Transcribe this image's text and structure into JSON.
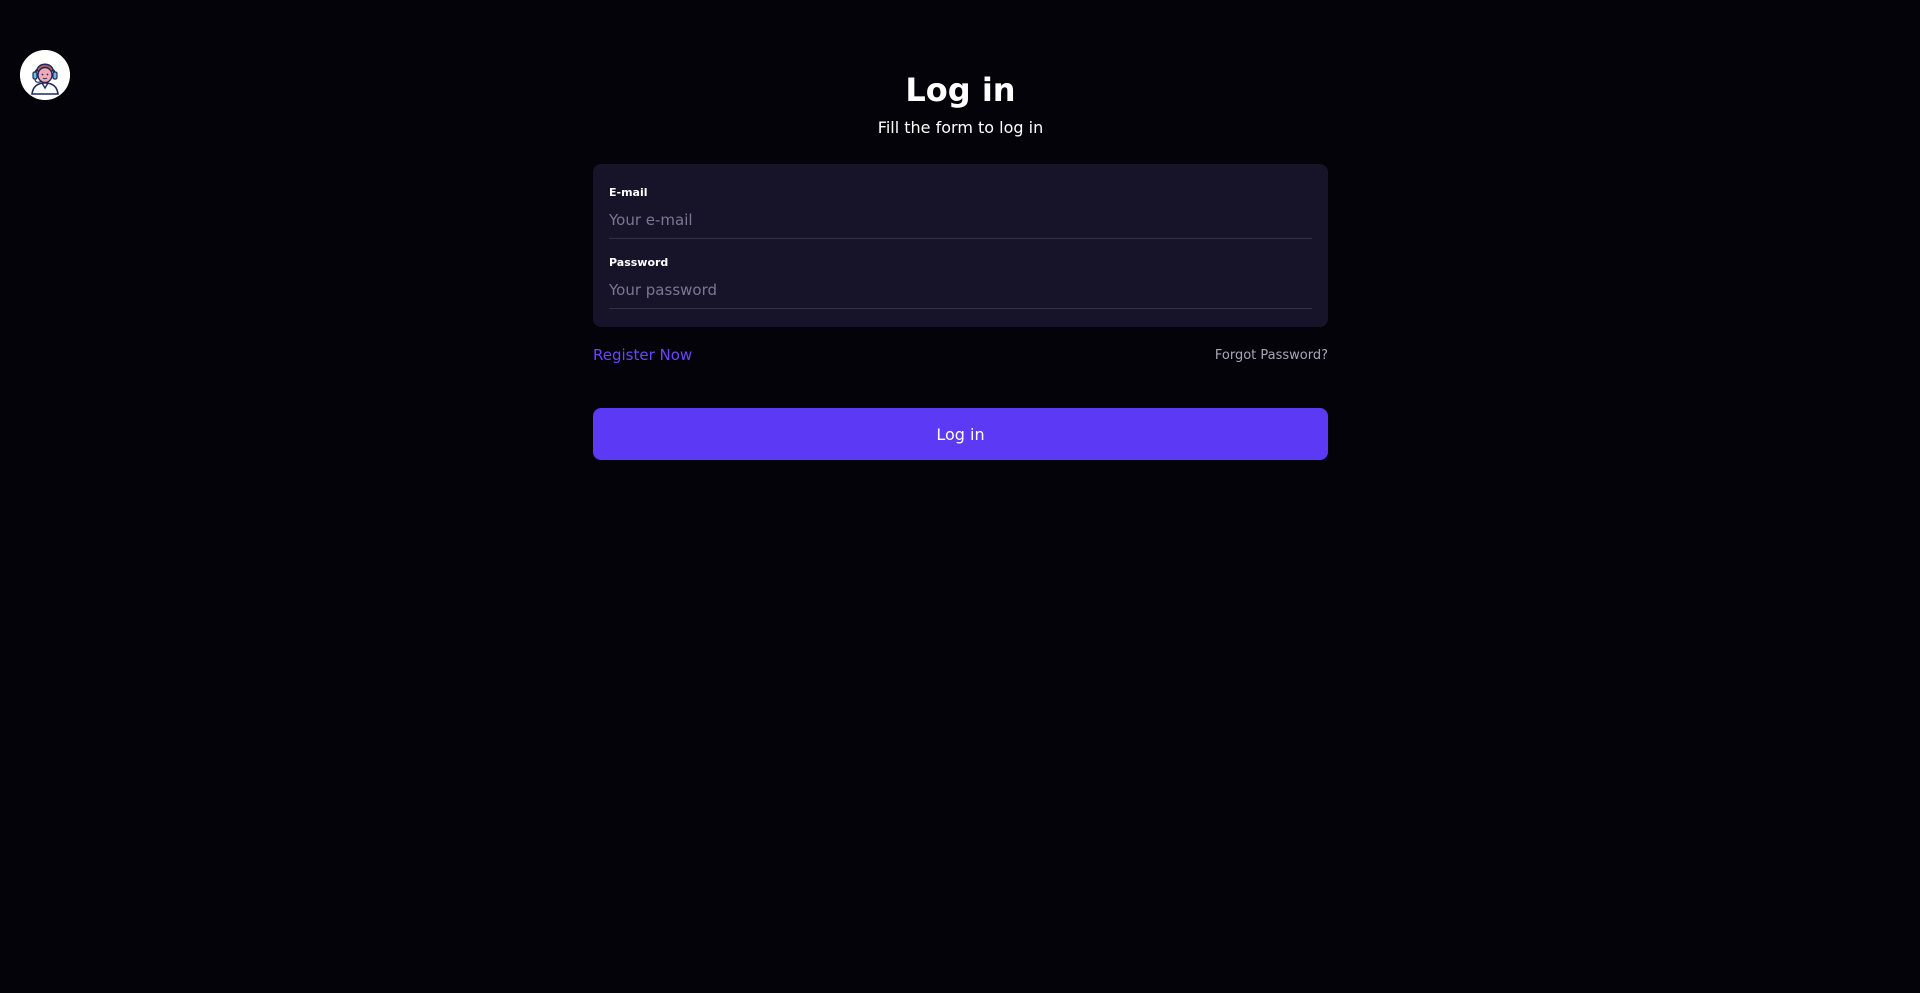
{
  "header": {
    "avatar_icon": "user-avatar-icon"
  },
  "page": {
    "title": "Log in",
    "subtitle": "Fill the form to log in"
  },
  "form": {
    "email": {
      "label": "E-mail",
      "placeholder": "Your e-mail",
      "value": ""
    },
    "password": {
      "label": "Password",
      "placeholder": "Your password",
      "value": ""
    }
  },
  "links": {
    "register": "Register Now",
    "forgot": "Forgot Password?"
  },
  "actions": {
    "login_label": "Log in"
  },
  "colors": {
    "background": "#04030a",
    "card": "#17142a",
    "accent": "#5b39f5",
    "link": "#6a46ff",
    "muted": "#a9a6b6"
  }
}
